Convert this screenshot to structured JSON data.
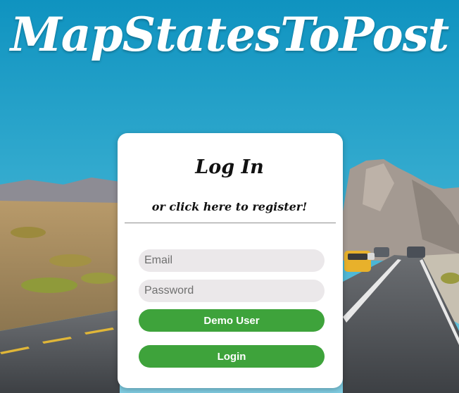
{
  "app": {
    "title": "MapStatesToPost"
  },
  "login_card": {
    "heading": "Log In",
    "register_link": "or click here to register!",
    "email": {
      "placeholder": "Email",
      "value": ""
    },
    "password": {
      "placeholder": "Password",
      "value": ""
    },
    "demo_button": "Demo User",
    "login_button": "Login"
  },
  "colors": {
    "sky": "#1aa0c8",
    "button_green": "#3ea33b",
    "input_bg": "#ebe8ea",
    "card_bg": "#ffffff"
  }
}
